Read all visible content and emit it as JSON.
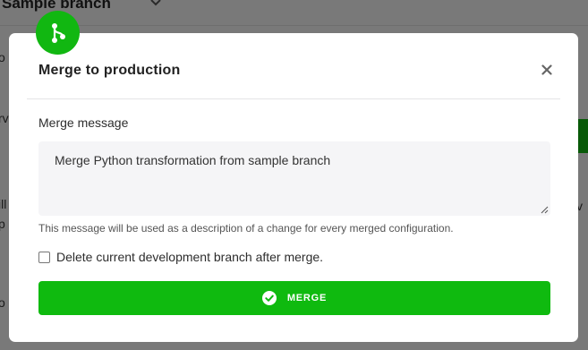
{
  "background": {
    "branch_name": "Sample branch"
  },
  "modal": {
    "title": "Merge to production",
    "badge_icon": "branch-icon",
    "close_icon": "close-icon",
    "message_label": "Merge message",
    "message_value": "Merge Python transformation from sample branch",
    "help_text": "This message will be used as a description of a change for every merged configuration.",
    "delete_branch_label": "Delete current development branch after merge.",
    "delete_branch_checked": false,
    "merge_button_label": "MERGE",
    "merge_button_icon": "check-circle-icon"
  },
  "colors": {
    "accent_green": "#0fba0f",
    "badge_green": "#11b711"
  }
}
